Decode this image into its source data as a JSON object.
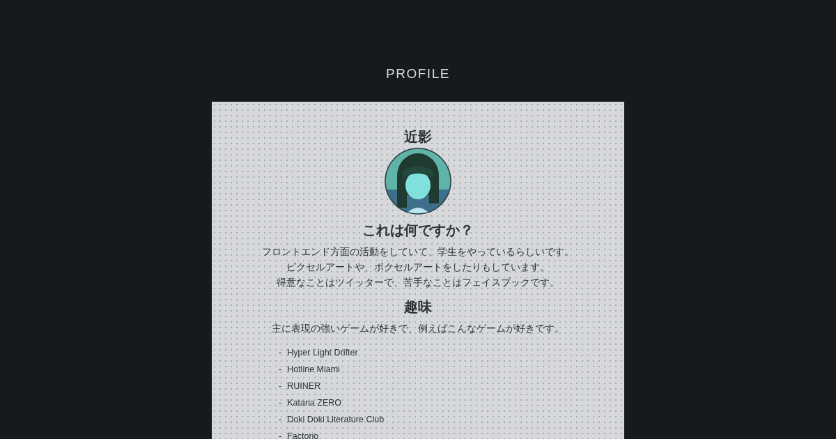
{
  "page_title": "PROFILE",
  "sections": [
    {
      "heading": "近影"
    },
    {
      "heading": "これは何ですか？",
      "paragraphs": [
        "フロントエンド方面の活動をしていて、学生をやっているらしいです。",
        "ピクセルアートや、ボクセルアートをしたりもしています。",
        "得意なことはツイッターで、苦手なことはフェイスブックです。"
      ]
    },
    {
      "heading": "趣味",
      "paragraphs": [
        "主に表現の強いゲームが好きで、例えばこんなゲームが好きです。"
      ],
      "list": [
        {
          "marker": "-",
          "text": "Hyper Light Drifter"
        },
        {
          "marker": "-",
          "text": "Hotline Miami"
        },
        {
          "marker": "-",
          "text": "RUINER"
        },
        {
          "marker": "-",
          "text": "Katana ZERO"
        },
        {
          "marker": "-",
          "text": "Doki Doki Literature Club"
        },
        {
          "marker": "-",
          "text": "Factorio"
        }
      ]
    }
  ]
}
